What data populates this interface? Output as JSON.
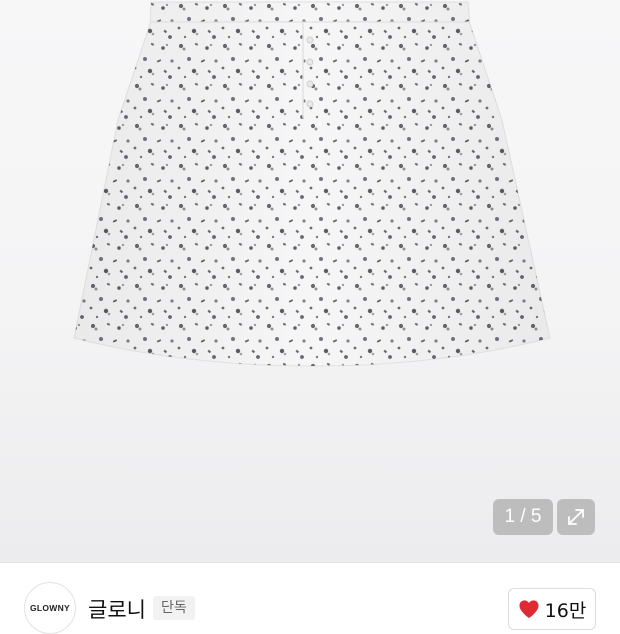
{
  "gallery": {
    "pager_text": "1 / 5",
    "image_subject": "floral print mini skirt",
    "expand_icon": "expand-arrows-icon"
  },
  "brand": {
    "logo_text": "GLOWNY",
    "name": "글로니",
    "badge": "단독"
  },
  "like": {
    "icon": "heart-icon",
    "count": "16만",
    "heart_color": "#e02a33"
  }
}
